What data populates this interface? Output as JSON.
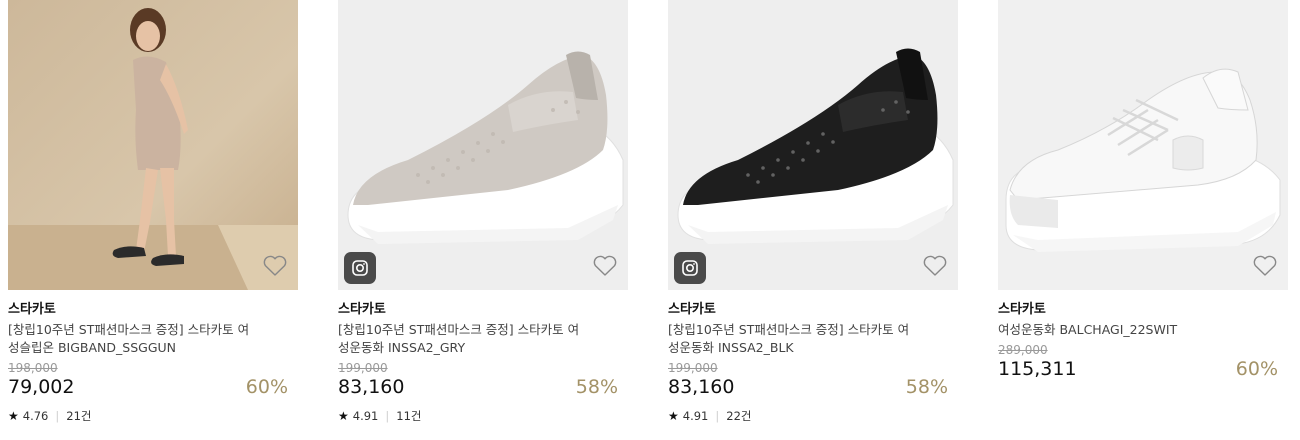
{
  "products": [
    {
      "brand": "스타카토",
      "name": "[창립10주년 ST패션마스크 증정] 스타카토 여성슬립온 BIGBAND_SSGGUN",
      "original_price": "198,000",
      "price": "79,002",
      "discount": "60%",
      "rating": "4.76",
      "reviews": "21건",
      "image": "woman-wearing-slip-on",
      "has_instagram": false
    },
    {
      "brand": "스타카토",
      "name": "[창립10주년 ST패션마스크 증정] 스타카토 여성운동화 INSSA2_GRY",
      "original_price": "199,000",
      "price": "83,160",
      "discount": "58%",
      "rating": "4.91",
      "reviews": "11건",
      "image": "grey-knit-slip-on-sneaker",
      "has_instagram": true
    },
    {
      "brand": "스타카토",
      "name": "[창립10주년 ST패션마스크 증정] 스타카토 여성운동화 INSSA2_BLK",
      "original_price": "199,000",
      "price": "83,160",
      "discount": "58%",
      "rating": "4.91",
      "reviews": "22건",
      "image": "black-knit-slip-on-sneaker",
      "has_instagram": true
    },
    {
      "brand": "스타카토",
      "name": "여성운동화 BALCHAGI_22SWIT",
      "original_price": "289,000",
      "price": "115,311",
      "discount": "60%",
      "rating": "",
      "reviews": "",
      "image": "white-chunky-sneaker",
      "has_instagram": false
    }
  ],
  "icons": {
    "wishlist": "heart-outline-icon",
    "instagram": "instagram-icon",
    "rating": "star-icon"
  },
  "colors": {
    "discount": "#a39267",
    "strike_price": "#9a9a9a",
    "instagram_badge": "#4a4a4a"
  }
}
